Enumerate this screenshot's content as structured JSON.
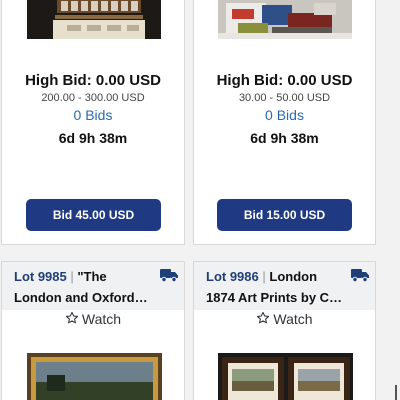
{
  "cards": [
    {
      "high_bid": "High Bid: 0.00 USD",
      "range": "200.00 - 300.00 USD",
      "bids": "0 Bids",
      "time_left": "6d 9h 38m",
      "bid_button": "Bid 45.00 USD"
    },
    {
      "high_bid": "High Bid: 0.00 USD",
      "range": "30.00 - 50.00 USD",
      "bids": "0 Bids",
      "time_left": "6d 9h 38m",
      "bid_button": "Bid 15.00 USD"
    }
  ],
  "lots": [
    {
      "lot_number": "Lot 9985",
      "separator": "|",
      "title_line1": "\"The",
      "title_line2": "London and Oxford…",
      "watch_label": "Watch",
      "shipping_icon": "truck-icon"
    },
    {
      "lot_number": "Lot 9986",
      "separator": "|",
      "title_line1": "London",
      "title_line2": "1874 Art Prints by C…",
      "watch_label": "Watch",
      "shipping_icon": "truck-icon"
    }
  ],
  "colors": {
    "button_bg": "#1f3a82",
    "link": "#2a6bb0",
    "lot_number": "#1f3f78",
    "truck": "#1f3f78"
  }
}
